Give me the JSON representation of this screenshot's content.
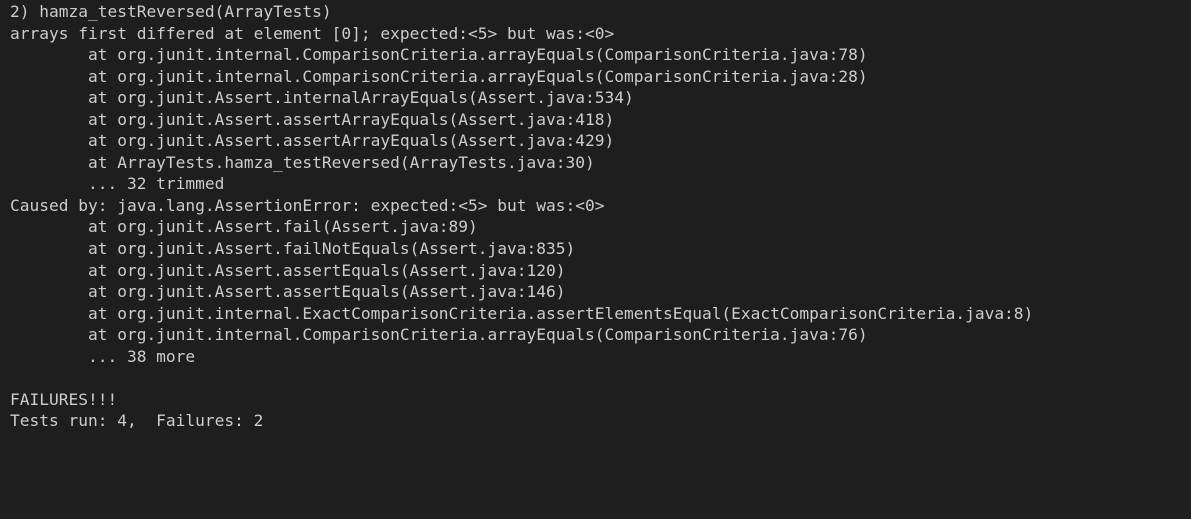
{
  "terminal": {
    "lines": [
      "2) hamza_testReversed(ArrayTests)",
      "arrays first differed at element [0]; expected:<5> but was:<0>",
      "        at org.junit.internal.ComparisonCriteria.arrayEquals(ComparisonCriteria.java:78)",
      "        at org.junit.internal.ComparisonCriteria.arrayEquals(ComparisonCriteria.java:28)",
      "        at org.junit.Assert.internalArrayEquals(Assert.java:534)",
      "        at org.junit.Assert.assertArrayEquals(Assert.java:418)",
      "        at org.junit.Assert.assertArrayEquals(Assert.java:429)",
      "        at ArrayTests.hamza_testReversed(ArrayTests.java:30)",
      "        ... 32 trimmed",
      "Caused by: java.lang.AssertionError: expected:<5> but was:<0>",
      "        at org.junit.Assert.fail(Assert.java:89)",
      "        at org.junit.Assert.failNotEquals(Assert.java:835)",
      "        at org.junit.Assert.assertEquals(Assert.java:120)",
      "        at org.junit.Assert.assertEquals(Assert.java:146)",
      "        at org.junit.internal.ExactComparisonCriteria.assertElementsEqual(ExactComparisonCriteria.java:8)",
      "        at org.junit.internal.ComparisonCriteria.arrayEquals(ComparisonCriteria.java:76)",
      "        ... 38 more",
      "",
      "FAILURES!!!",
      "Tests run: 4,  Failures: 2"
    ]
  },
  "colors": {
    "background": "#1e1e1e",
    "text": "#cccccc"
  }
}
